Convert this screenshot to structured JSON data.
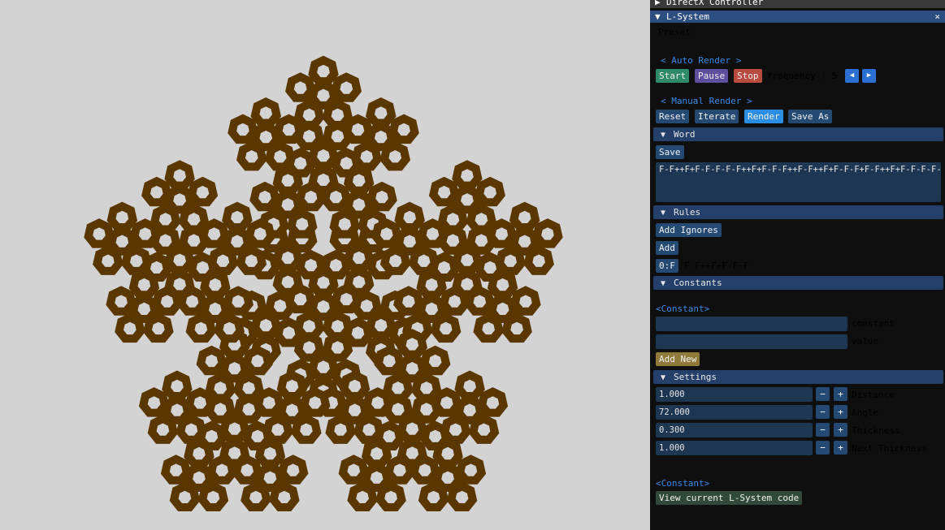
{
  "colors": {
    "fractal": "#5a3600",
    "fractal_hole": "#d3d3d3",
    "background": "#d3d3d3",
    "panel": "#0f0f10",
    "accent": "#3a8be5"
  },
  "directx": {
    "title": "DirectX Controller"
  },
  "lsystem": {
    "title": "L-System",
    "close_icon": "×",
    "preset": "Preset",
    "auto_render": {
      "heading": "< Auto Render >",
      "start": "Start",
      "pause": "Pause",
      "stop": "Stop",
      "frequency_label": "frequency : 5",
      "left_icon": "◀",
      "right_icon": "▶"
    },
    "manual_render": {
      "heading": "< Manual Render >",
      "reset": "Reset",
      "iterate": "Iterate",
      "render": "Render",
      "save_as": "Save As"
    },
    "word": {
      "header": "Word",
      "save": "Save",
      "value": "F-F++F+F-F-F-F-F++F+F-F-F++F-F++F+F-F-F+F-F++F+F-F-F-F-F++F+F-F-F++F-F"
    },
    "rules": {
      "header": "Rules",
      "add_ignores": "Add Ignores",
      "add": "Add",
      "items": [
        {
          "key": "0:F",
          "value": "F-F++F+F-F-F"
        }
      ]
    },
    "constants": {
      "header": "Constants",
      "label": "<Constant>",
      "constant_label": "constant",
      "value_label": "value",
      "constant_value": "",
      "value_value": "",
      "add_new": "Add New"
    },
    "settings": {
      "header": "Settings",
      "minus": "−",
      "plus": "+",
      "rows": [
        {
          "value": "1.000",
          "label": "Distance"
        },
        {
          "value": "72.000",
          "label": "Angle"
        },
        {
          "value": "0.300",
          "label": "Thickness"
        },
        {
          "value": "1.000",
          "label": "Next Thickness"
        }
      ]
    },
    "footer": {
      "label": "<Constant>",
      "view_code": "View current L-System code"
    }
  }
}
